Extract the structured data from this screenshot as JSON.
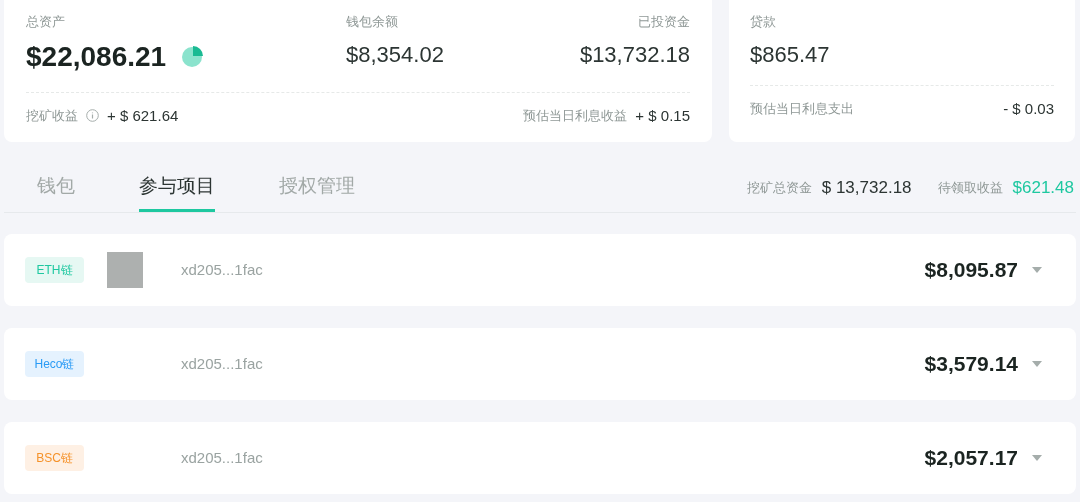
{
  "assets_card": {
    "total": {
      "label": "总资产",
      "value": "$22,086.21"
    },
    "wallet": {
      "label": "钱包余额",
      "value": "$8,354.02"
    },
    "invested": {
      "label": "已投资金",
      "value": "$13,732.18"
    },
    "mining": {
      "label": "挖矿收益",
      "value": "+ $ 621.64"
    },
    "daily_interest": {
      "label": "预估当日利息收益",
      "value": "+ $ 0.15"
    }
  },
  "loan_card": {
    "label": "贷款",
    "value": "$865.47",
    "daily_cost": {
      "label": "预估当日利息支出",
      "value": "- $ 0.03"
    }
  },
  "tabs": [
    {
      "label": "钱包",
      "selected": false
    },
    {
      "label": "参与项目",
      "selected": true
    },
    {
      "label": "授权管理",
      "selected": false
    }
  ],
  "summary": [
    {
      "label": "挖矿总资金",
      "value": "$ 13,732.18",
      "kind": "plain"
    },
    {
      "label": "待领取收益",
      "value": "$621.48",
      "kind": "highlight"
    }
  ],
  "projects": [
    {
      "chain": "ETH链",
      "color": "#1ec8a0",
      "address": "xd205...1fac",
      "amount": "$8,095.87",
      "redacted": true
    },
    {
      "chain": "Heco链",
      "color": "#2a9bf5",
      "address": "xd205...1fac",
      "amount": "$3,579.14",
      "redacted": false
    },
    {
      "chain": "BSC链",
      "color": "#f5922a",
      "address": "xd205...1fac",
      "amount": "$2,057.17",
      "redacted": false
    }
  ]
}
